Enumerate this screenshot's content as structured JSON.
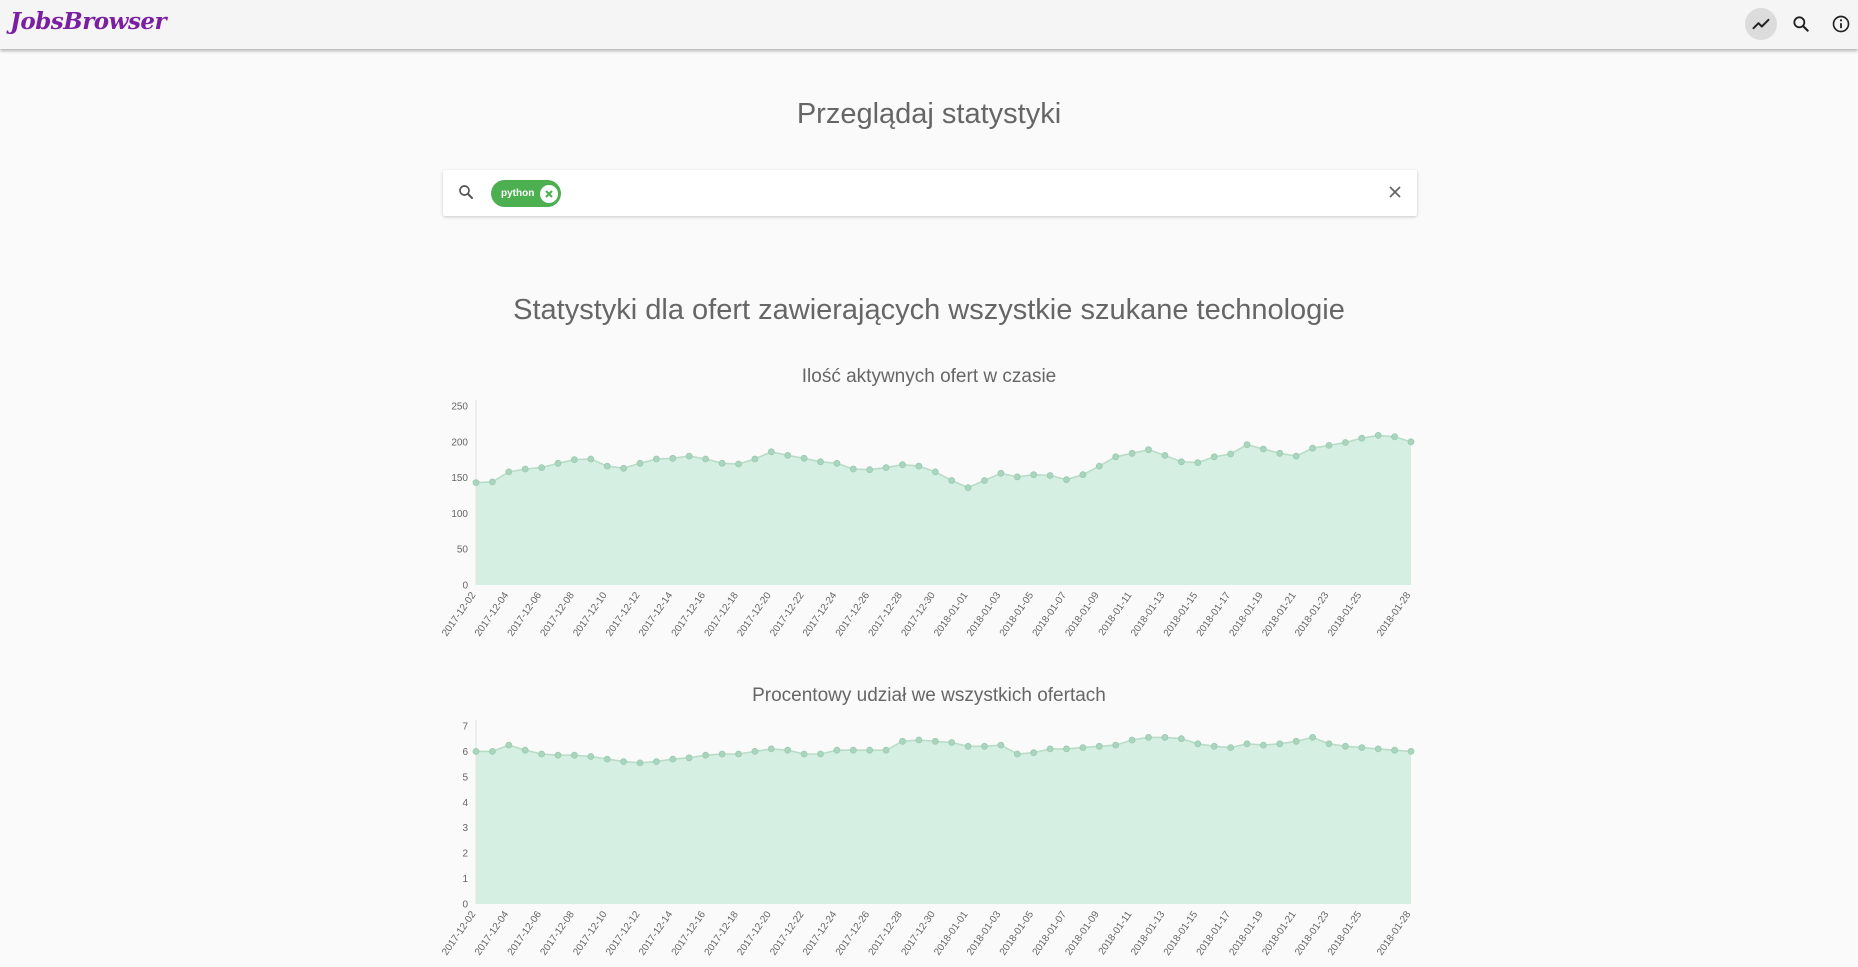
{
  "app": {
    "brand": "JobsBrowser"
  },
  "appbar": {
    "icons": [
      "trending-up-icon",
      "search-icon",
      "info-icon"
    ],
    "active": "trending-up-icon"
  },
  "page": {
    "title": "Przeglądaj statystyki"
  },
  "search": {
    "chips": [
      {
        "label": "python"
      }
    ],
    "placeholder": ""
  },
  "section": {
    "title": "Statystyki dla ofert zawierających wszystkie szukane technologie"
  },
  "colors": {
    "brand": "#7b1fa2",
    "chip": "#4caf50",
    "area_fill": "#d5f0e2",
    "point": "#a9d4bd"
  },
  "chart_data": [
    {
      "type": "area",
      "title": "Ilość aktywnych ofert w czasie",
      "ylim": [
        0,
        250
      ],
      "yticks": [
        0,
        50,
        100,
        150,
        200,
        250
      ],
      "x": [
        "2017-12-02",
        "2017-12-03",
        "2017-12-04",
        "2017-12-05",
        "2017-12-06",
        "2017-12-07",
        "2017-12-08",
        "2017-12-09",
        "2017-12-10",
        "2017-12-11",
        "2017-12-12",
        "2017-12-13",
        "2017-12-14",
        "2017-12-15",
        "2017-12-16",
        "2017-12-17",
        "2017-12-18",
        "2017-12-19",
        "2017-12-20",
        "2017-12-21",
        "2017-12-22",
        "2017-12-23",
        "2017-12-24",
        "2017-12-25",
        "2017-12-26",
        "2017-12-27",
        "2017-12-28",
        "2017-12-29",
        "2017-12-30",
        "2017-12-31",
        "2018-01-01",
        "2018-01-02",
        "2018-01-03",
        "2018-01-04",
        "2018-01-05",
        "2018-01-06",
        "2018-01-07",
        "2018-01-08",
        "2018-01-09",
        "2018-01-10",
        "2018-01-11",
        "2018-01-12",
        "2018-01-13",
        "2018-01-14",
        "2018-01-15",
        "2018-01-16",
        "2018-01-17",
        "2018-01-18",
        "2018-01-19",
        "2018-01-20",
        "2018-01-21",
        "2018-01-22",
        "2018-01-23",
        "2018-01-24",
        "2018-01-25",
        "2018-01-26",
        "2018-01-27",
        "2018-01-28"
      ],
      "xtick_labels": [
        "2017-12-02",
        "2017-12-04",
        "2017-12-06",
        "2017-12-08",
        "2017-12-10",
        "2017-12-12",
        "2017-12-14",
        "2017-12-16",
        "2017-12-18",
        "2017-12-20",
        "2017-12-22",
        "2017-12-24",
        "2017-12-26",
        "2017-12-28",
        "2017-12-30",
        "2018-01-01",
        "2018-01-03",
        "2018-01-05",
        "2018-01-07",
        "2018-01-09",
        "2018-01-11",
        "2018-01-13",
        "2018-01-15",
        "2018-01-17",
        "2018-01-19",
        "2018-01-21",
        "2018-01-23",
        "2018-01-25",
        "2018-01-28"
      ],
      "values": [
        143,
        144,
        158,
        162,
        164,
        170,
        175,
        176,
        166,
        163,
        170,
        176,
        177,
        180,
        176,
        170,
        169,
        176,
        186,
        181,
        177,
        172,
        170,
        162,
        161,
        164,
        168,
        166,
        158,
        146,
        136,
        146,
        156,
        151,
        154,
        153,
        147,
        154,
        166,
        179,
        184,
        189,
        181,
        172,
        171,
        179,
        183,
        196,
        190,
        184,
        180,
        191,
        195,
        199,
        205,
        209,
        207,
        200
      ],
      "grid": false,
      "legend": "none"
    },
    {
      "type": "area",
      "title": "Procentowy udział we wszystkich ofertach",
      "ylim": [
        0,
        7
      ],
      "yticks": [
        0,
        1,
        2,
        3,
        4,
        5,
        6,
        7
      ],
      "x": [
        "2017-12-02",
        "2017-12-03",
        "2017-12-04",
        "2017-12-05",
        "2017-12-06",
        "2017-12-07",
        "2017-12-08",
        "2017-12-09",
        "2017-12-10",
        "2017-12-11",
        "2017-12-12",
        "2017-12-13",
        "2017-12-14",
        "2017-12-15",
        "2017-12-16",
        "2017-12-17",
        "2017-12-18",
        "2017-12-19",
        "2017-12-20",
        "2017-12-21",
        "2017-12-22",
        "2017-12-23",
        "2017-12-24",
        "2017-12-25",
        "2017-12-26",
        "2017-12-27",
        "2017-12-28",
        "2017-12-29",
        "2017-12-30",
        "2017-12-31",
        "2018-01-01",
        "2018-01-02",
        "2018-01-03",
        "2018-01-04",
        "2018-01-05",
        "2018-01-06",
        "2018-01-07",
        "2018-01-08",
        "2018-01-09",
        "2018-01-10",
        "2018-01-11",
        "2018-01-12",
        "2018-01-13",
        "2018-01-14",
        "2018-01-15",
        "2018-01-16",
        "2018-01-17",
        "2018-01-18",
        "2018-01-19",
        "2018-01-20",
        "2018-01-21",
        "2018-01-22",
        "2018-01-23",
        "2018-01-24",
        "2018-01-25",
        "2018-01-26",
        "2018-01-27",
        "2018-01-28"
      ],
      "xtick_labels": [
        "2017-12-02",
        "2017-12-04",
        "2017-12-06",
        "2017-12-08",
        "2017-12-10",
        "2017-12-12",
        "2017-12-14",
        "2017-12-16",
        "2017-12-18",
        "2017-12-20",
        "2017-12-22",
        "2017-12-24",
        "2017-12-26",
        "2017-12-28",
        "2017-12-30",
        "2018-01-01",
        "2018-01-03",
        "2018-01-05",
        "2018-01-07",
        "2018-01-09",
        "2018-01-11",
        "2018-01-13",
        "2018-01-15",
        "2018-01-17",
        "2018-01-19",
        "2018-01-21",
        "2018-01-23",
        "2018-01-25",
        "2018-01-28"
      ],
      "values": [
        6.0,
        6.0,
        6.25,
        6.05,
        5.9,
        5.85,
        5.85,
        5.8,
        5.7,
        5.6,
        5.55,
        5.6,
        5.7,
        5.75,
        5.85,
        5.9,
        5.9,
        6.0,
        6.1,
        6.05,
        5.9,
        5.9,
        6.05,
        6.05,
        6.05,
        6.05,
        6.4,
        6.45,
        6.4,
        6.35,
        6.2,
        6.2,
        6.25,
        5.9,
        5.95,
        6.1,
        6.1,
        6.15,
        6.2,
        6.25,
        6.45,
        6.55,
        6.55,
        6.5,
        6.3,
        6.2,
        6.15,
        6.3,
        6.25,
        6.3,
        6.4,
        6.55,
        6.3,
        6.2,
        6.15,
        6.1,
        6.05,
        6.0
      ],
      "grid": false,
      "legend": "none"
    }
  ]
}
